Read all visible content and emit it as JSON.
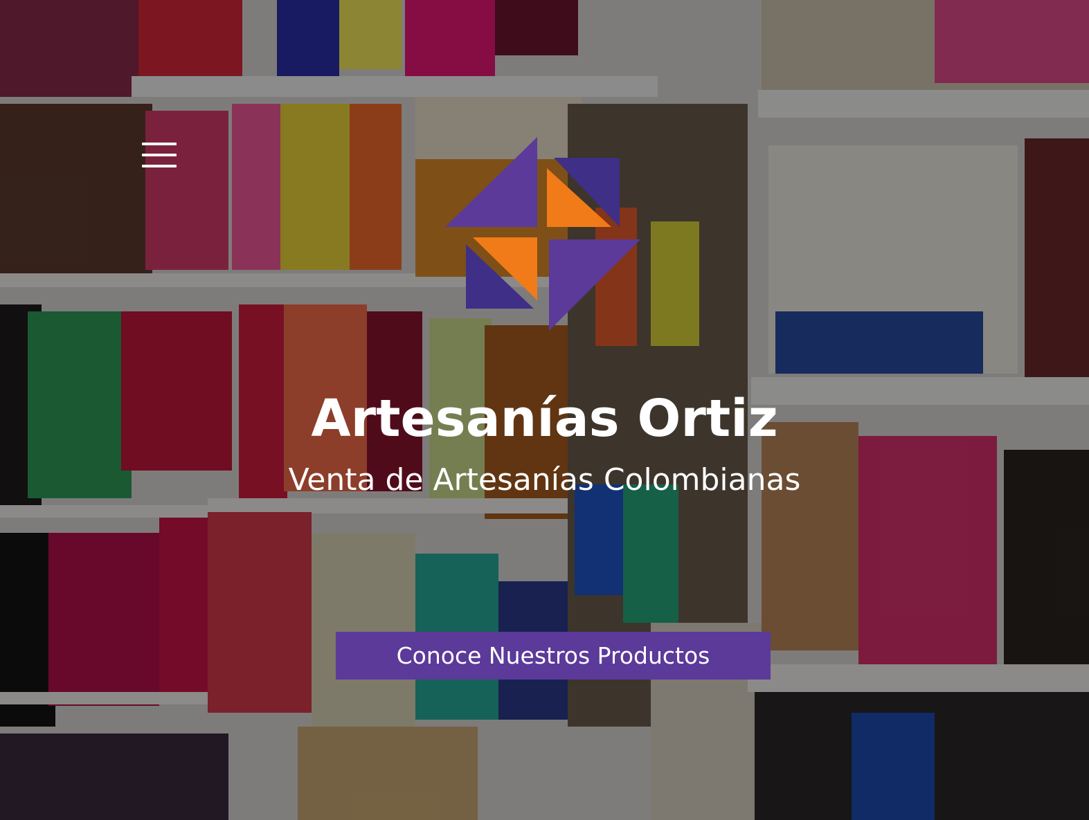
{
  "hero": {
    "background_image": "colorful-handicrafts-shop-shelves",
    "title": "Artesanías Ortiz",
    "subtitle": "Venta de Artesanías Colombianas",
    "cta_label": "Conoce Nuestros Productos"
  },
  "nav": {
    "menu_icon": "hamburger-menu-icon"
  },
  "logo": {
    "icon": "pinwheel-triangles-logo"
  },
  "colors": {
    "purple": "#5b3a9a",
    "dark_purple": "#3f2f86",
    "orange": "#f07b18",
    "text": "#ffffff",
    "overlay": "rgba(0,0,0,0.42)"
  }
}
